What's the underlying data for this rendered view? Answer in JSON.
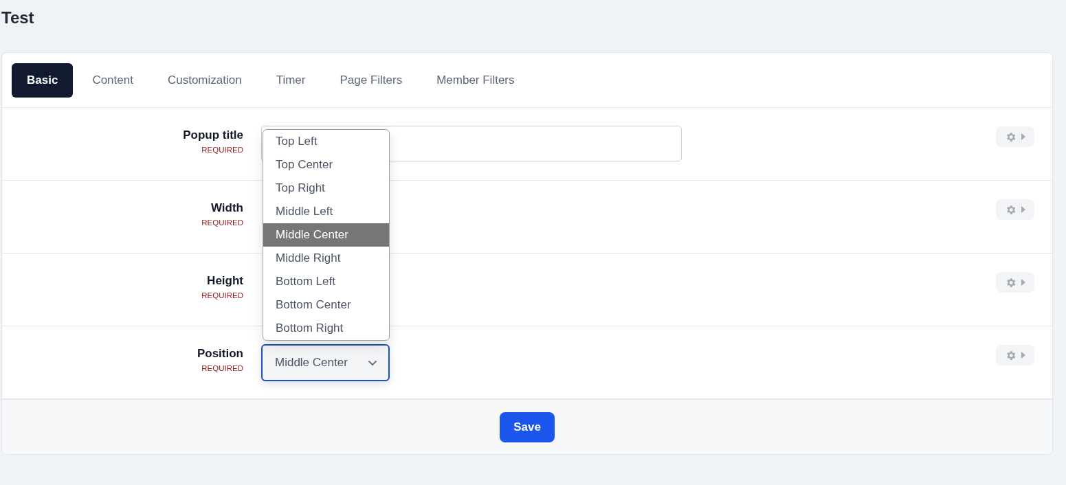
{
  "page_title": "Test",
  "tabs": [
    {
      "label": "Basic",
      "selected": true
    },
    {
      "label": "Content",
      "selected": false
    },
    {
      "label": "Customization",
      "selected": false
    },
    {
      "label": "Timer",
      "selected": false
    },
    {
      "label": "Page Filters",
      "selected": false
    },
    {
      "label": "Member Filters",
      "selected": false
    }
  ],
  "fields": [
    {
      "label": "Popup title",
      "note": "REQUIRED",
      "kind": "text"
    },
    {
      "label": "Width",
      "note": "REQUIRED",
      "kind": "covered"
    },
    {
      "label": "Height",
      "note": "REQUIRED",
      "kind": "covered"
    },
    {
      "label": "Position",
      "note": "REQUIRED",
      "kind": "select",
      "value": "Middle Center",
      "open": true,
      "options": [
        {
          "label": "Top Left",
          "selected": false
        },
        {
          "label": "Top Center",
          "selected": false
        },
        {
          "label": "Top Right",
          "selected": false
        },
        {
          "label": "Middle Left",
          "selected": false
        },
        {
          "label": "Middle Center",
          "selected": true
        },
        {
          "label": "Middle Right",
          "selected": false
        },
        {
          "label": "Bottom Left",
          "selected": false
        },
        {
          "label": "Bottom Center",
          "selected": false
        },
        {
          "label": "Bottom Right",
          "selected": false
        }
      ]
    }
  ],
  "save_button": "Save"
}
